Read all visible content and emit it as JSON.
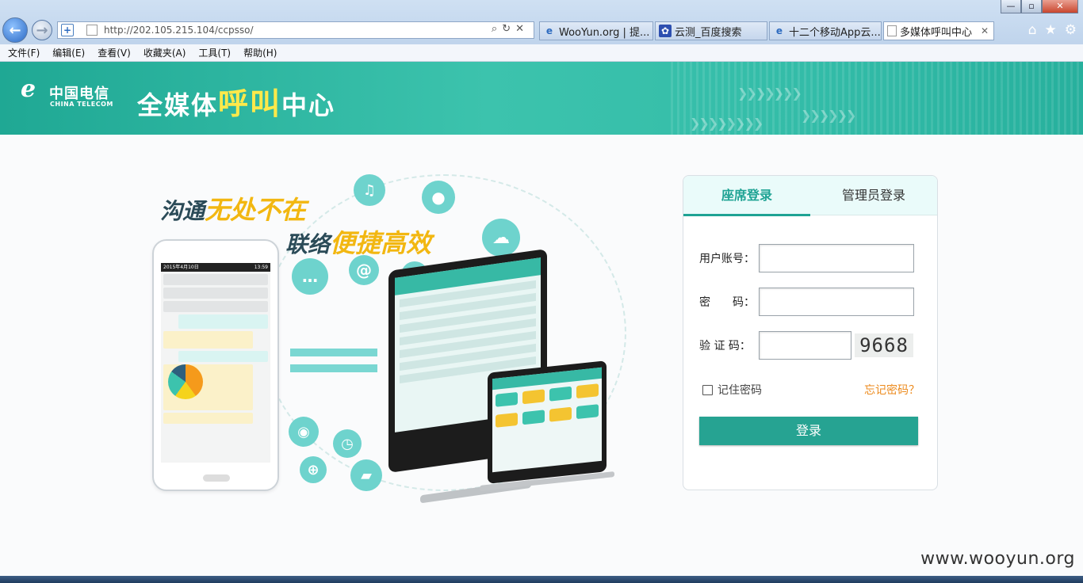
{
  "browser": {
    "url": "http://202.105.215.104/ccpsso/",
    "tabs": [
      {
        "title": "WooYun.org | 提...",
        "active": false
      },
      {
        "title": "云测_百度搜索",
        "active": false
      },
      {
        "title": "十二个移动App云...",
        "active": false
      },
      {
        "title": "多媒体呼叫中心",
        "active": true
      }
    ],
    "menu": [
      "文件(F)",
      "编辑(E)",
      "查看(V)",
      "收藏夹(A)",
      "工具(T)",
      "帮助(H)"
    ],
    "window_controls": {
      "minimize": "—",
      "maximize": "▫",
      "close": "✕"
    }
  },
  "banner": {
    "logo_cn": "中国电信",
    "logo_en": "CHINA TELECOM",
    "title_pre": "全媒体",
    "title_highlight": "呼叫",
    "title_post": "中心"
  },
  "illustration": {
    "slogan1_dark": "沟通",
    "slogan1_gold": "无处不在",
    "slogan2_dark": "联络",
    "slogan2_gold": "便捷高效",
    "phone_status_date": "2015年4月10日",
    "phone_status_time": "13:59"
  },
  "login": {
    "tabs": [
      "座席登录",
      "管理员登录"
    ],
    "active_tab": "座席登录",
    "username_label": "用户账号：",
    "password_label": "密　　码：",
    "captcha_label": "验 证 码：",
    "captcha_value": "9668",
    "remember_label": "记住密码",
    "forgot_label": "忘记密码？",
    "submit_label": "登录"
  },
  "watermark": "www.wooyun.org",
  "colors": {
    "brand_teal": "#26a392",
    "accent_yellow": "#ffe94a",
    "slogan_gold": "#f2b711",
    "forgot_orange": "#ec8a1c"
  }
}
